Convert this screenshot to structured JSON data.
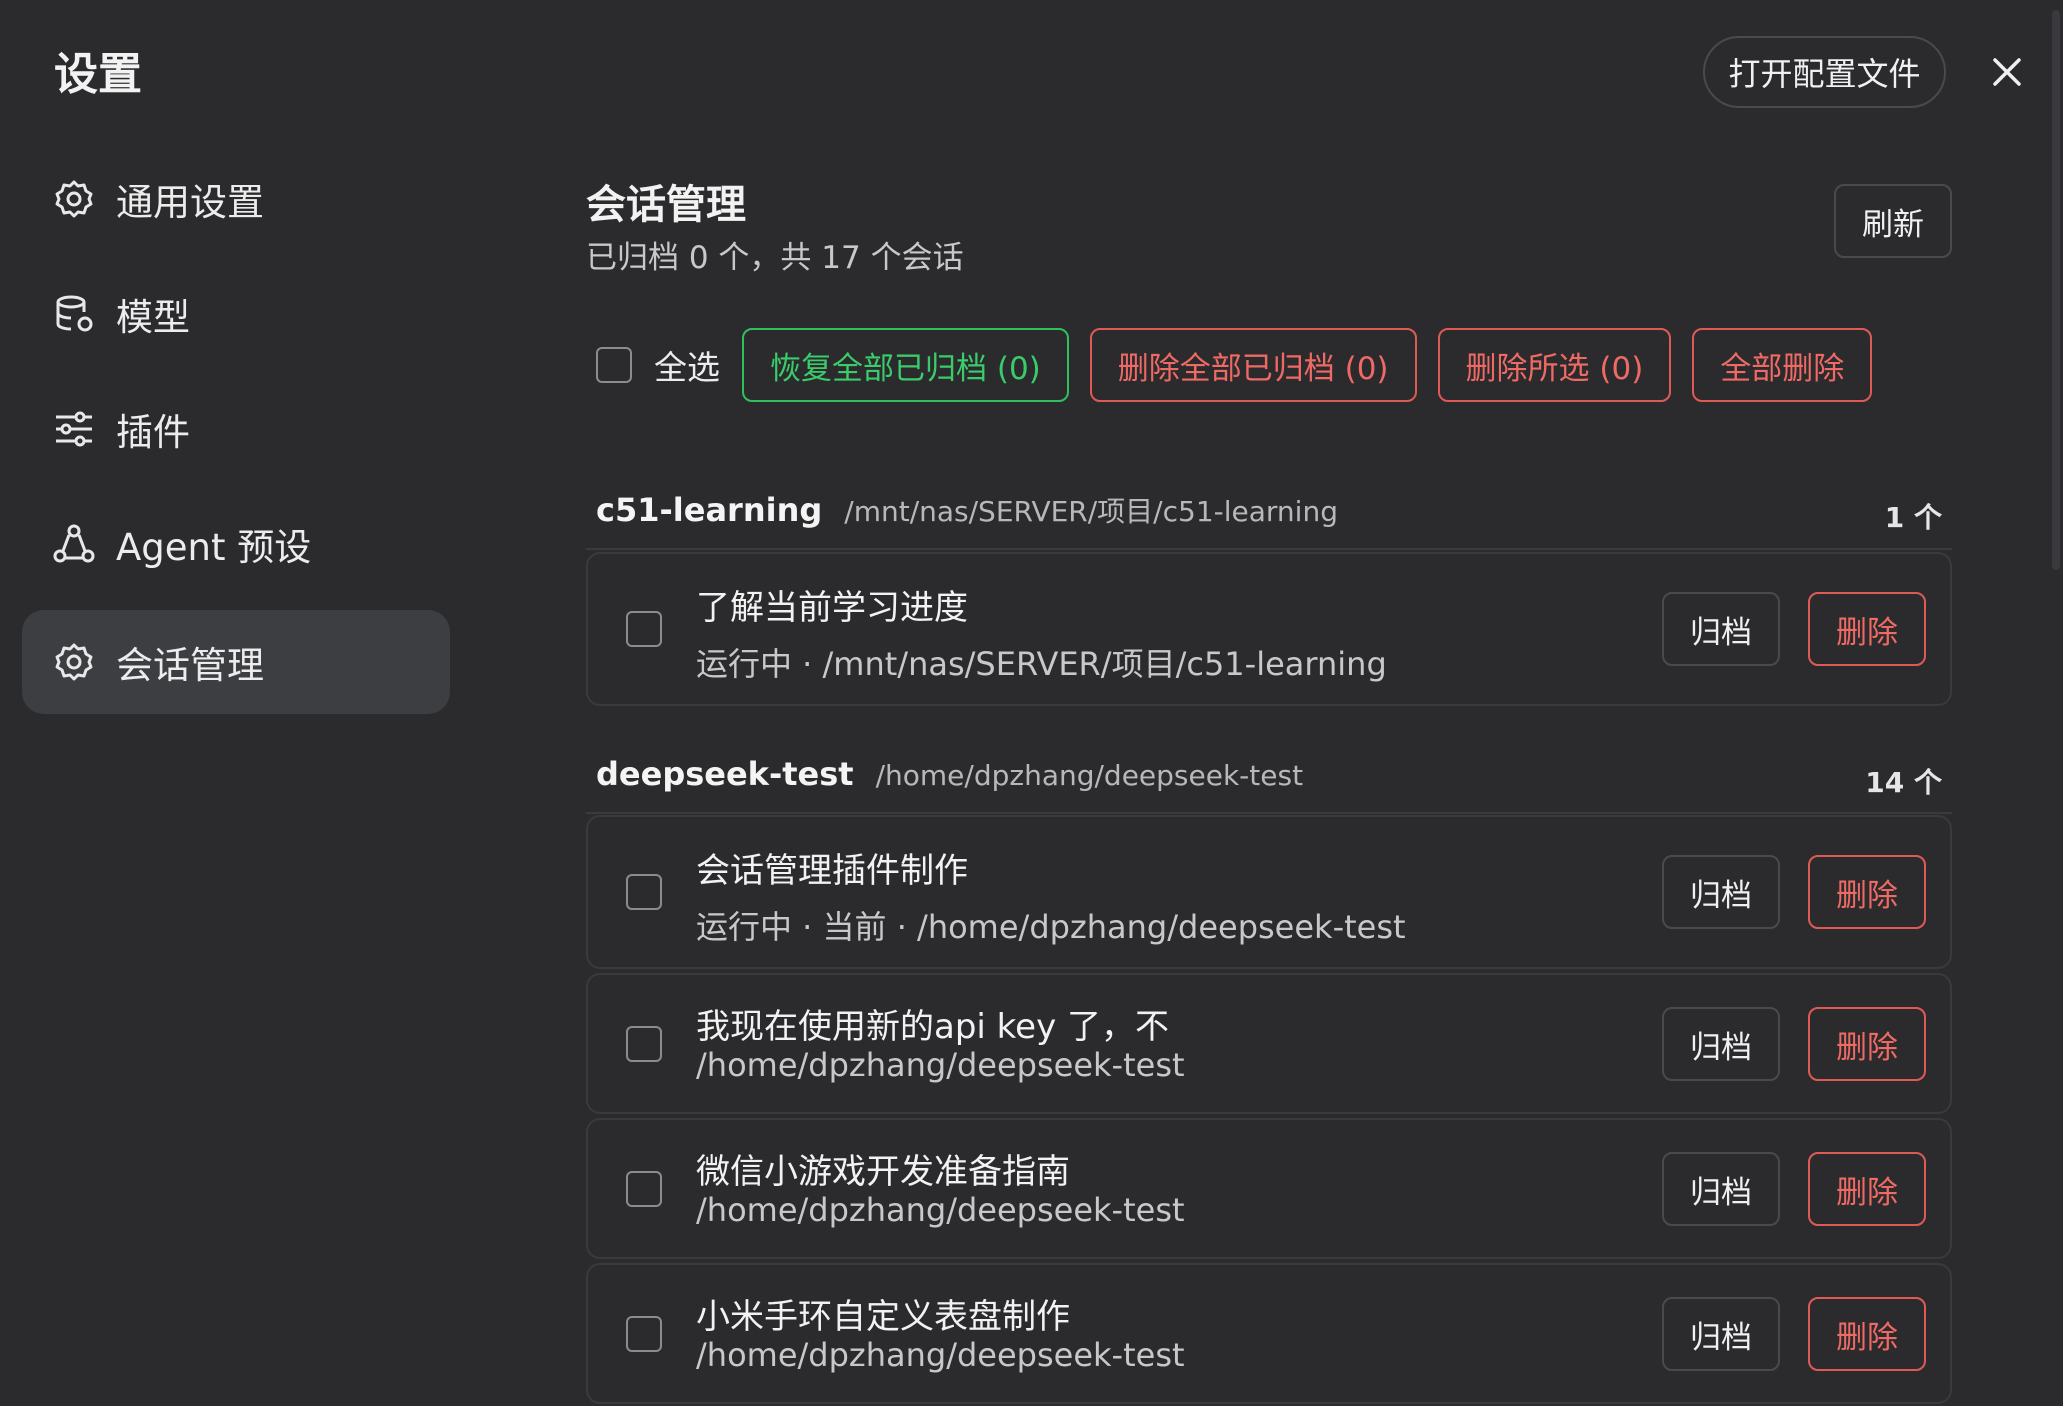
{
  "header": {
    "title": "设置",
    "open_config_label": "打开配置文件",
    "close_icon": "close-icon"
  },
  "sidebar": {
    "items": [
      {
        "label": "通用设置",
        "icon": "gear-icon"
      },
      {
        "label": "模型",
        "icon": "database-gear-icon"
      },
      {
        "label": "插件",
        "icon": "sliders-icon"
      },
      {
        "label": "Agent 预设",
        "icon": "agent-icon"
      },
      {
        "label": "会话管理",
        "icon": "gear-icon",
        "active": true
      }
    ]
  },
  "main": {
    "title": "会话管理",
    "subtitle": "已归档 0 个，共 17 个会话",
    "refresh_label": "刷新",
    "toolbar": {
      "select_all_label": "全选",
      "restore_all_label": "恢复全部已归档 (0)",
      "delete_archived_label": "删除全部已归档 (0)",
      "delete_selected_label": "删除所选 (0)",
      "delete_all_label": "全部删除"
    },
    "groups": [
      {
        "name": "c51-learning",
        "path": "/mnt/nas/SERVER/项目/c51-learning",
        "count": "1 个",
        "sessions": [
          {
            "title": "了解当前学习进度",
            "sub": "运行中 · /mnt/nas/SERVER/项目/c51-learning",
            "archive_label": "归档",
            "delete_label": "删除"
          }
        ]
      },
      {
        "name": "deepseek-test",
        "path": "/home/dpzhang/deepseek-test",
        "count": "14 个",
        "sessions": [
          {
            "title": "会话管理插件制作",
            "sub": "运行中 · 当前 · /home/dpzhang/deepseek-test",
            "archive_label": "归档",
            "delete_label": "删除"
          },
          {
            "title": "我现在使用新的api key 了，不",
            "sub": "/home/dpzhang/deepseek-test",
            "archive_label": "归档",
            "delete_label": "删除"
          },
          {
            "title": "微信小游戏开发准备指南",
            "sub": "/home/dpzhang/deepseek-test",
            "archive_label": "归档",
            "delete_label": "删除"
          },
          {
            "title": "小米手环自定义表盘制作",
            "sub": "/home/dpzhang/deepseek-test",
            "archive_label": "归档",
            "delete_label": "删除"
          }
        ]
      }
    ]
  },
  "colors": {
    "background": "#2b2b2e",
    "active_item": "#3d3e42",
    "danger": "#ef6a64",
    "success": "#3acb6a",
    "border": "#4a4a4e"
  }
}
